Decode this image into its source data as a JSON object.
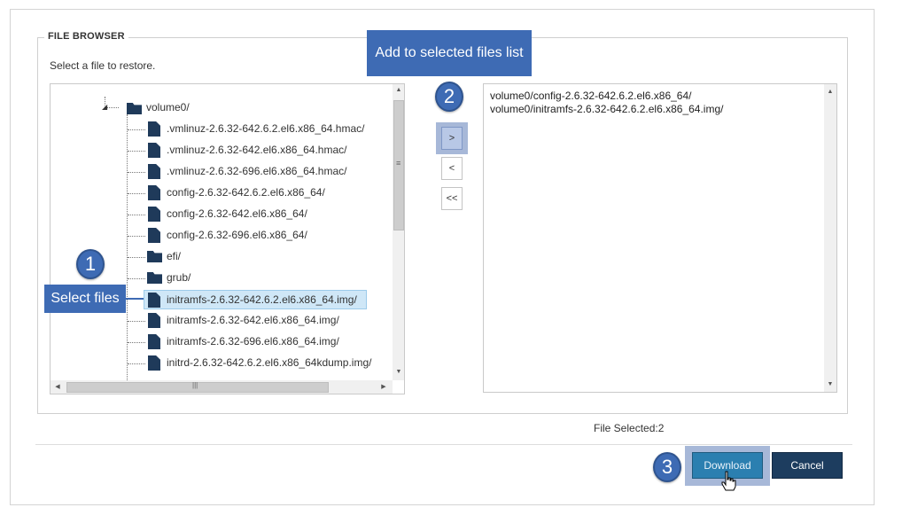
{
  "file_browser": {
    "legend": "FILE BROWSER",
    "instruction": "Select a file to restore.",
    "tree": {
      "root": {
        "label": "volume0/",
        "icon": "folder-icon"
      },
      "items": [
        {
          "label": ".vmlinuz-2.6.32-642.6.2.el6.x86_64.hmac/",
          "icon": "file-icon"
        },
        {
          "label": ".vmlinuz-2.6.32-642.el6.x86_64.hmac/",
          "icon": "file-icon"
        },
        {
          "label": ".vmlinuz-2.6.32-696.el6.x86_64.hmac/",
          "icon": "file-icon"
        },
        {
          "label": "config-2.6.32-642.6.2.el6.x86_64/",
          "icon": "file-icon"
        },
        {
          "label": "config-2.6.32-642.el6.x86_64/",
          "icon": "file-icon"
        },
        {
          "label": "config-2.6.32-696.el6.x86_64/",
          "icon": "file-icon"
        },
        {
          "label": "efi/",
          "icon": "folder-icon"
        },
        {
          "label": "grub/",
          "icon": "folder-icon"
        },
        {
          "label": "initramfs-2.6.32-642.6.2.el6.x86_64.img/",
          "icon": "file-icon",
          "selected": true
        },
        {
          "label": "initramfs-2.6.32-642.el6.x86_64.img/",
          "icon": "file-icon"
        },
        {
          "label": "initramfs-2.6.32-696.el6.x86_64.img/",
          "icon": "file-icon"
        },
        {
          "label": "initrd-2.6.32-642.6.2.el6.x86_64kdump.img/",
          "icon": "file-icon"
        }
      ]
    },
    "transfer_buttons": {
      "add": ">",
      "remove": "<",
      "remove_all": "<<"
    },
    "selected_files": [
      "volume0/config-2.6.32-642.6.2.el6.x86_64/",
      "volume0/initramfs-2.6.32-642.6.2.el6.x86_64.img/"
    ]
  },
  "callouts": {
    "step1": {
      "number": "1",
      "text": "Select files"
    },
    "step2": {
      "number": "2",
      "text": "Add to selected files list"
    },
    "step3": {
      "number": "3"
    }
  },
  "status": {
    "file_selected": "File Selected:2"
  },
  "actions": {
    "download": "Download",
    "cancel": "Cancel"
  },
  "colors": {
    "callout": "#3e6bb4",
    "download": "#2b7fb0",
    "cancel": "#1d3d5f",
    "selection": "#cfe7f7",
    "icon": "#1f3a5a"
  }
}
